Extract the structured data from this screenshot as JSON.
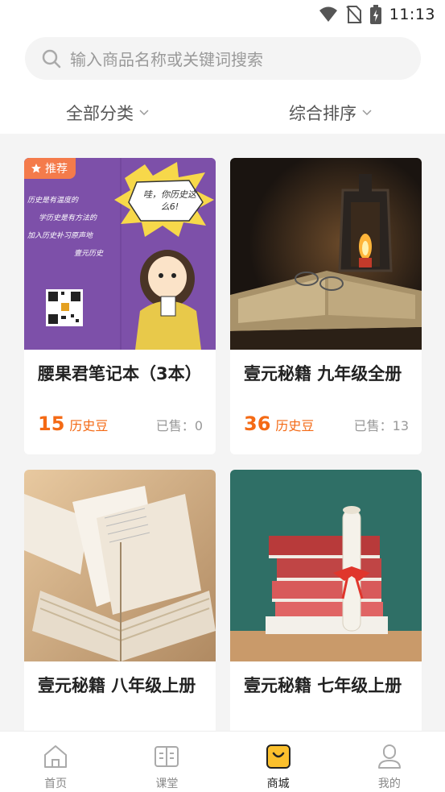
{
  "status_bar": {
    "time": "11:13",
    "icons": [
      "wifi-icon",
      "no-sim-icon",
      "battery-charging-icon"
    ]
  },
  "search": {
    "placeholder": "输入商品名称或关键词搜索"
  },
  "filters": {
    "category": "全部分类",
    "sort": "综合排序"
  },
  "products": [
    {
      "title": "腰果君笔记本（3本）",
      "badge": "推荐",
      "price": "15",
      "price_unit": "历史豆",
      "sold_label": "已售：",
      "sold": "0",
      "image_text": {
        "line1": "历史是有温度的",
        "line2": "学历史是有方法的",
        "line3": "加入历史补习原声地",
        "line4": "壹元历史",
        "bubble": "哇，你历史这么6!"
      }
    },
    {
      "title": "壹元秘籍 九年级全册",
      "price": "36",
      "price_unit": "历史豆",
      "sold_label": "已售：",
      "sold": "13"
    },
    {
      "title": "壹元秘籍 八年级上册",
      "price": "",
      "price_unit": "",
      "sold_label": "",
      "sold": ""
    },
    {
      "title": "壹元秘籍 七年级上册",
      "price": "",
      "price_unit": "",
      "sold_label": "",
      "sold": ""
    }
  ],
  "tabbar": [
    {
      "label": "首页",
      "icon": "home-icon",
      "active": false
    },
    {
      "label": "课堂",
      "icon": "book-icon",
      "active": false
    },
    {
      "label": "商城",
      "icon": "shop-icon",
      "active": true
    },
    {
      "label": "我的",
      "icon": "profile-icon",
      "active": false
    }
  ],
  "colors": {
    "accent": "#f46a15",
    "active_tab": "#fbc02d",
    "badge": "#f47b4b"
  }
}
